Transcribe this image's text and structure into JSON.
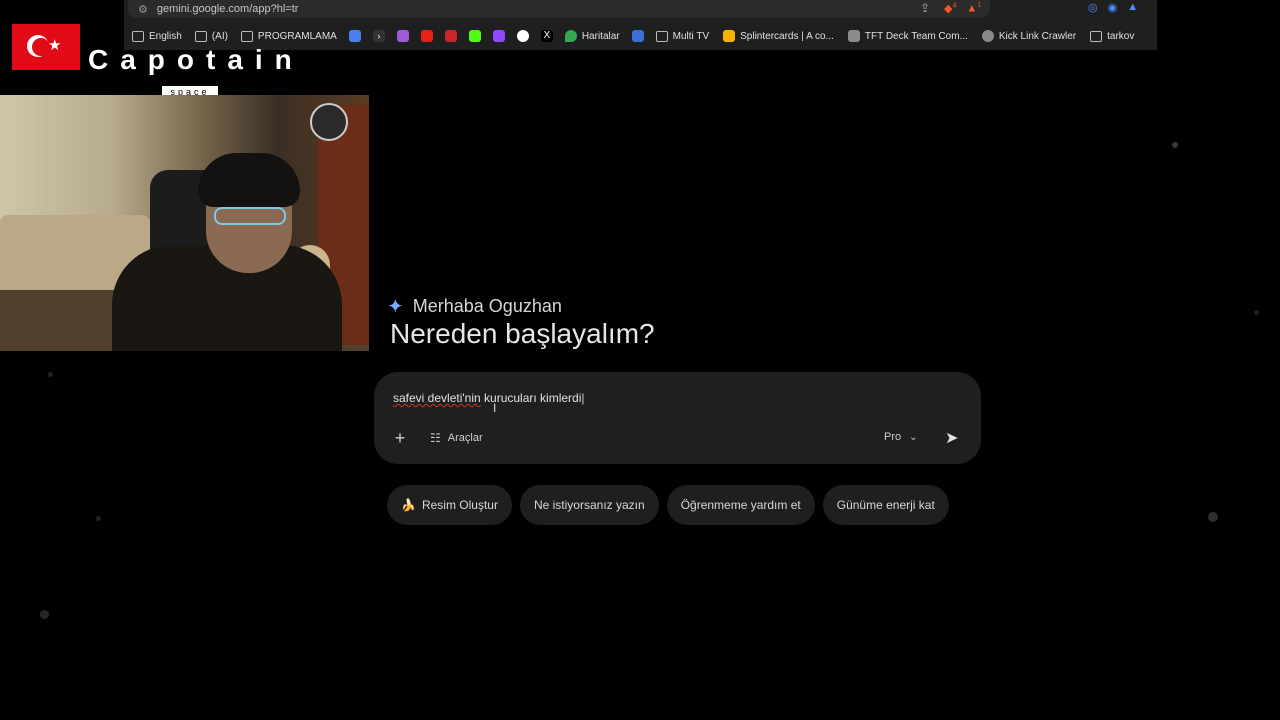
{
  "browser": {
    "url": "gemini.google.com/app?hl=tr",
    "bookmarks": [
      {
        "label": "English",
        "icon": "folder-icon"
      },
      {
        "label": "(AI)",
        "icon": "folder-icon"
      },
      {
        "label": "PROGRAMLAMA",
        "icon": "folder-icon"
      },
      {
        "label": "Haritalar",
        "icon": "maps-icon"
      },
      {
        "label": "Multi TV",
        "icon": "tv-icon"
      },
      {
        "label": "Splintercards | A co...",
        "icon": "bookmark-icon"
      },
      {
        "label": "TFT Deck Team Com...",
        "icon": "bookmark-icon"
      },
      {
        "label": "Kick Link Crawler",
        "icon": "globe-icon"
      },
      {
        "label": "tarkov",
        "icon": "folder-icon"
      }
    ],
    "badges": {
      "ext1": "4",
      "ext2": "1"
    }
  },
  "overlay": {
    "brand": "Capotain",
    "brand_sub": "space"
  },
  "gemini": {
    "greeting": "Merhaba Oguzhan",
    "headline": "Nereden başlayalım?",
    "prompt_text": "safevi devleti'nin kurucuları kimlerdi",
    "prompt_misspelled": "safevi devleti'nin",
    "prompt_rest": " kurucuları kimlerdi",
    "tools_label": "Araçlar",
    "model_label": "Pro",
    "chips": [
      {
        "label": "Resim Oluştur",
        "emoji": "🍌"
      },
      {
        "label": "Ne istiyorsanız yazın"
      },
      {
        "label": "Öğrenmeme yardım et"
      },
      {
        "label": "Günüme enerji kat"
      }
    ]
  },
  "colors": {
    "background": "#000000",
    "prompt_bg": "#1e1f20",
    "flag_red": "#e30a17",
    "accent_blue": "#4d8fff"
  }
}
